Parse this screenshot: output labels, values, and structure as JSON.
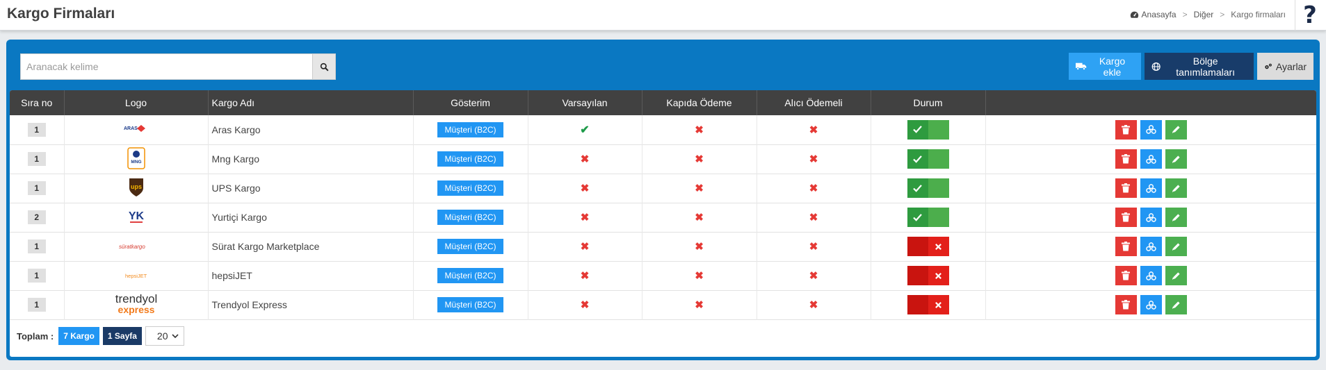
{
  "header": {
    "title": "Kargo Firmaları",
    "breadcrumb": [
      "Anasayfa",
      "Diğer",
      "Kargo firmaları"
    ],
    "help": "?"
  },
  "search": {
    "placeholder": "Aranacak kelime",
    "value": ""
  },
  "toolbar": {
    "add_label": "Kargo ekle",
    "regions_label": "Bölge tanımlamaları",
    "settings_label": "Ayarlar"
  },
  "table": {
    "columns": [
      "Sıra no",
      "Logo",
      "Kargo Adı",
      "Gösterim",
      "Varsayılan",
      "Kapıda Ödeme",
      "Alıcı Ödemeli",
      "Durum",
      ""
    ],
    "rows": [
      {
        "order": "1",
        "logo_text": "ARAS",
        "name": "Aras Kargo",
        "display": "Müşteri (B2C)",
        "default": true,
        "cod": false,
        "receiver_pays": false,
        "active": true
      },
      {
        "order": "1",
        "logo_text": "MNG",
        "name": "Mng Kargo",
        "display": "Müşteri (B2C)",
        "default": false,
        "cod": false,
        "receiver_pays": false,
        "active": true
      },
      {
        "order": "1",
        "logo_text": "ups",
        "name": "UPS Kargo",
        "display": "Müşteri (B2C)",
        "default": false,
        "cod": false,
        "receiver_pays": false,
        "active": true
      },
      {
        "order": "2",
        "logo_text": "YK",
        "name": "Yurtiçi Kargo",
        "display": "Müşteri (B2C)",
        "default": false,
        "cod": false,
        "receiver_pays": false,
        "active": true
      },
      {
        "order": "1",
        "logo_text": "süratkargo",
        "name": "Sürat Kargo Marketplace",
        "display": "Müşteri (B2C)",
        "default": false,
        "cod": false,
        "receiver_pays": false,
        "active": false
      },
      {
        "order": "1",
        "logo_text": "hepsiJET",
        "name": "hepsiJET",
        "display": "Müşteri (B2C)",
        "default": false,
        "cod": false,
        "receiver_pays": false,
        "active": false
      },
      {
        "order": "1",
        "logo_text": "trendyol express",
        "name": "Trendyol Express",
        "display": "Müşteri (B2C)",
        "default": false,
        "cod": false,
        "receiver_pays": false,
        "active": false
      }
    ]
  },
  "footer": {
    "total_label": "Toplam :",
    "count_badge": "7 Kargo",
    "pages_badge": "1 Sayfa",
    "page_size": "20"
  },
  "colors": {
    "panel_blue": "#0a78c2",
    "header_dark": "#414141",
    "accent_blue": "#2196f3",
    "navy": "#183c6a",
    "success_green": "#4caf50",
    "danger_red": "#e53935"
  }
}
